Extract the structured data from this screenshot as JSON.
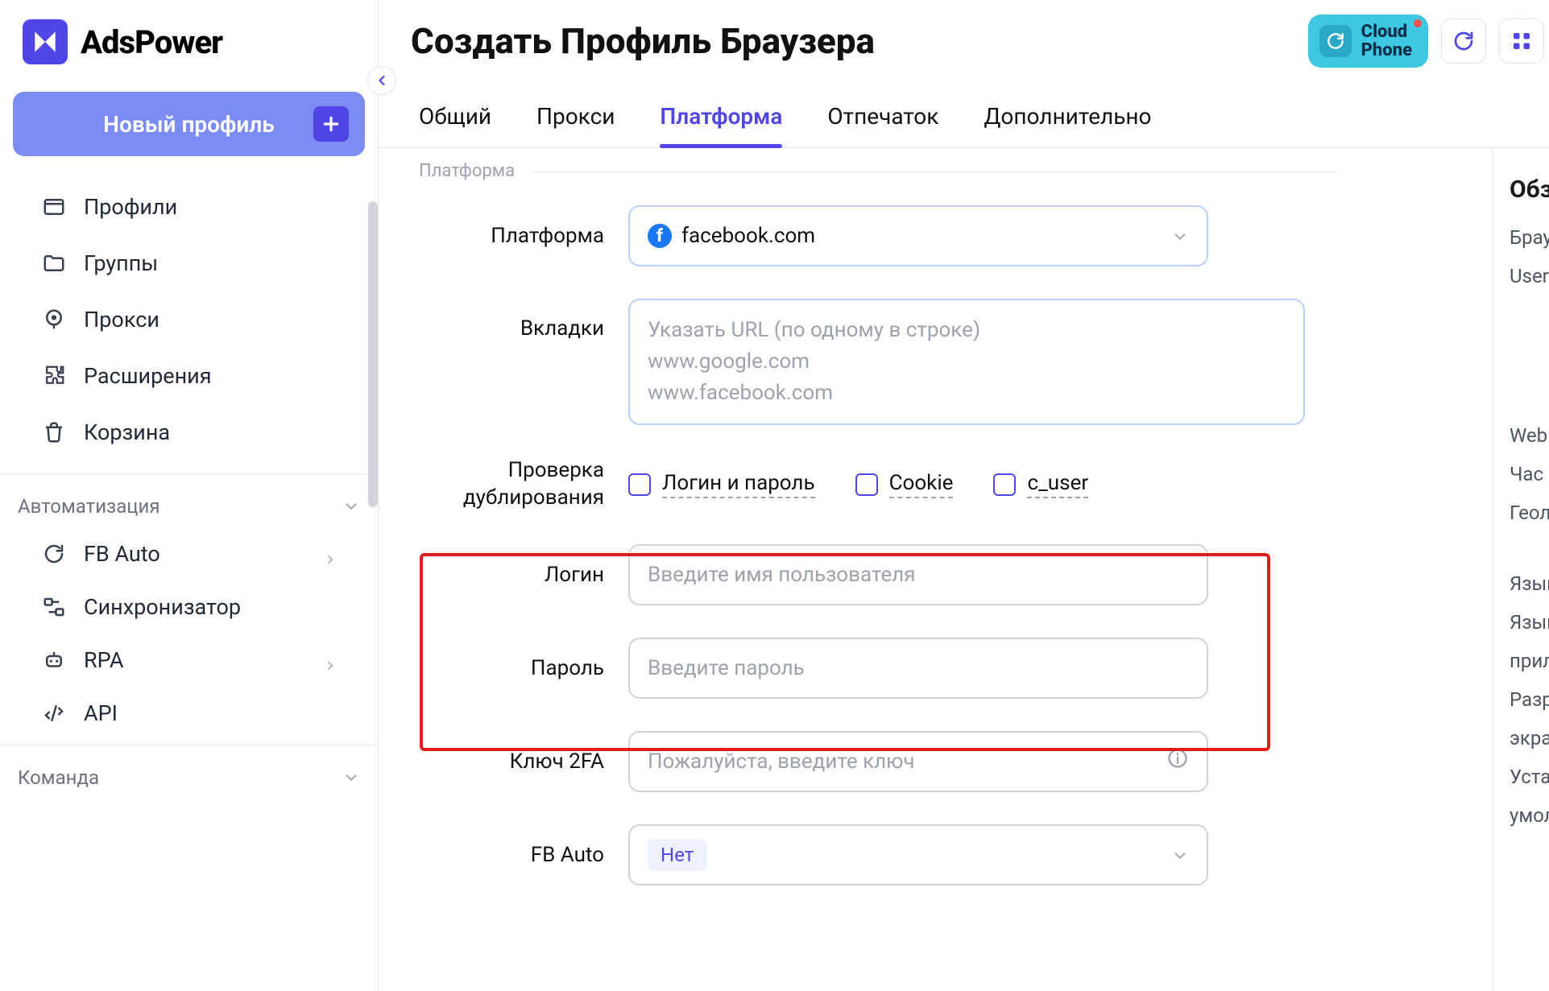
{
  "brand": "AdsPower",
  "sidebar": {
    "newProfile": "Новый профиль",
    "nav": {
      "profiles": "Профили",
      "groups": "Группы",
      "proxy": "Прокси",
      "extensions": "Расширения",
      "trash": "Корзина"
    },
    "automationHeader": "Автоматизация",
    "automation": {
      "fbauto": "FB Auto",
      "sync": "Синхронизатор",
      "rpa": "RPA",
      "api": "API"
    },
    "teamHeader": "Команда"
  },
  "topbar": {
    "title": "Создать Профиль Браузера",
    "cloudPhone1": "Cloud",
    "cloudPhone2": "Phone"
  },
  "tabs": {
    "general": "Общий",
    "proxy": "Прокси",
    "platform": "Платформа",
    "fingerprint": "Отпечаток",
    "advanced": "Дополнительно"
  },
  "form": {
    "sectionTitle": "Платформа",
    "platformLabel": "Платформа",
    "platformValue": "facebook.com",
    "tabsLabel": "Вкладки",
    "tabsPlaceholder": "Указать URL (по одному в строке)\nwww.google.com\nwww.facebook.com",
    "dupCheckLabel1": "Проверка",
    "dupCheckLabel2": "дублирования",
    "dup": {
      "loginpass": "Логин и пароль",
      "cookie": "Cookie",
      "cuser": "c_user"
    },
    "loginLabel": "Логин",
    "loginPlaceholder": "Введите имя пользователя",
    "passwordLabel": "Пароль",
    "passwordPlaceholder": "Введите пароль",
    "key2faLabel": "Ключ 2FA",
    "key2faPlaceholder": "Пожалуйста, введите ключ",
    "fbautoLabel": "FB Auto",
    "fbautoValue": "Нет"
  },
  "summary": {
    "title": "Обз",
    "items1": [
      "Брау",
      "User"
    ],
    "items2": [
      "Web",
      "Час",
      "Геол"
    ],
    "items3": [
      "Язык",
      "Язык",
      "прил",
      "Разр",
      "экра",
      "Уста",
      "умол"
    ]
  },
  "colors": {
    "primary": "#4f46e5",
    "accentRed": "#e11d1d",
    "cloudPhone": "#3ec7e0"
  }
}
